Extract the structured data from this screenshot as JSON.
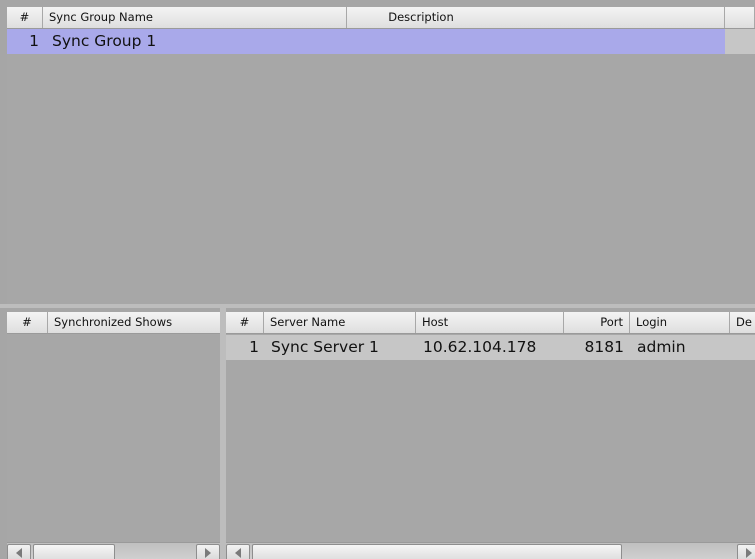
{
  "sync_groups": {
    "columns": {
      "num": "#",
      "name": "Sync Group Name",
      "description": "Description"
    },
    "rows": [
      {
        "num": "1",
        "name": "Sync Group 1",
        "description": ""
      }
    ]
  },
  "shows": {
    "columns": {
      "num": "#",
      "name": "Synchronized Shows"
    },
    "rows": []
  },
  "servers": {
    "columns": {
      "num": "#",
      "name": "Server Name",
      "host": "Host",
      "port": "Port",
      "login": "Login",
      "description": "De"
    },
    "rows": [
      {
        "num": "1",
        "name": "Sync Server 1",
        "host": "10.62.104.178",
        "port": "8181",
        "login": "admin"
      }
    ]
  },
  "colors": {
    "selection": "#a9a9ea",
    "background": "#a6a6a6",
    "header": "#e6e6e6"
  },
  "icons": {
    "scroll_left": "left-arrow-icon",
    "scroll_right": "right-arrow-icon"
  }
}
